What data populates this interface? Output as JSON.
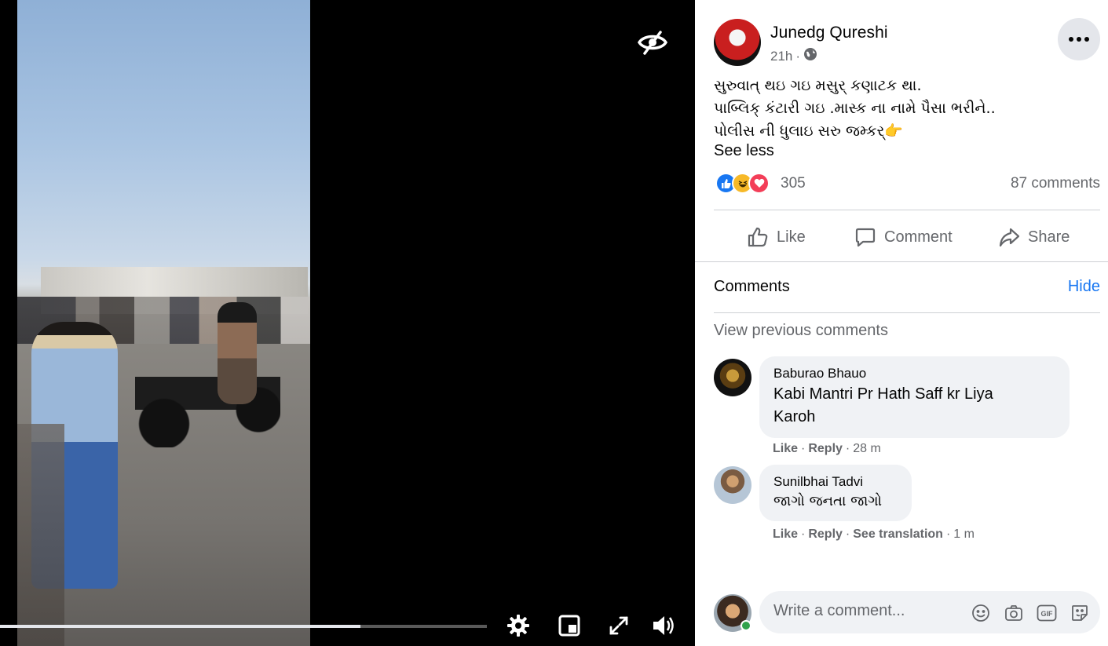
{
  "post": {
    "author_name": "Junedg Qureshi",
    "time": "21h",
    "text_lines": [
      "સુરુવાત્ થઇ ગઇ મસુર્ કણાટક થા.",
      "પાબ્લિક્ કંટારી ગઇ .માસ્ક ના નામે પૈસા ભરીને..",
      "પોલીસ ની ધુલાઇ સરુ જમ્કર્👉"
    ],
    "see_less": "See less",
    "reaction_count": "305",
    "comment_count": "87 comments"
  },
  "actions": {
    "like": "Like",
    "comment": "Comment",
    "share": "Share"
  },
  "comments_section": {
    "title": "Comments",
    "hide": "Hide",
    "view_previous": "View previous comments",
    "items": [
      {
        "name": "Baburao Bhauo",
        "text_line1": "Kabi Mantri Pr Hath Saff kr Liya",
        "text_line2": "Karoh",
        "like": "Like",
        "reply": "Reply",
        "time": "28 m"
      },
      {
        "name": "Sunilbhai Tadvi",
        "text": "જાગો જનતા જાગો",
        "like": "Like",
        "reply": "Reply",
        "see_translation": "See translation",
        "time": "1 m"
      }
    ],
    "composer_placeholder": "Write a comment..."
  },
  "video": {
    "progress": 0.74
  },
  "icons": {
    "eye": "eye-slash-icon",
    "settings": "gear-icon",
    "pip": "picture-in-picture-icon",
    "fullscreen": "fullscreen-icon",
    "volume": "volume-icon",
    "globe": "globe-icon",
    "more": "more-dots-icon",
    "emoji": "emoji-icon",
    "camera": "camera-icon",
    "gif": "gif-icon",
    "sticker": "sticker-icon"
  },
  "colors": {
    "link": "#1877f2",
    "secondary_text": "#65676b",
    "bubble": "#f0f2f5",
    "online": "#31a24c"
  }
}
